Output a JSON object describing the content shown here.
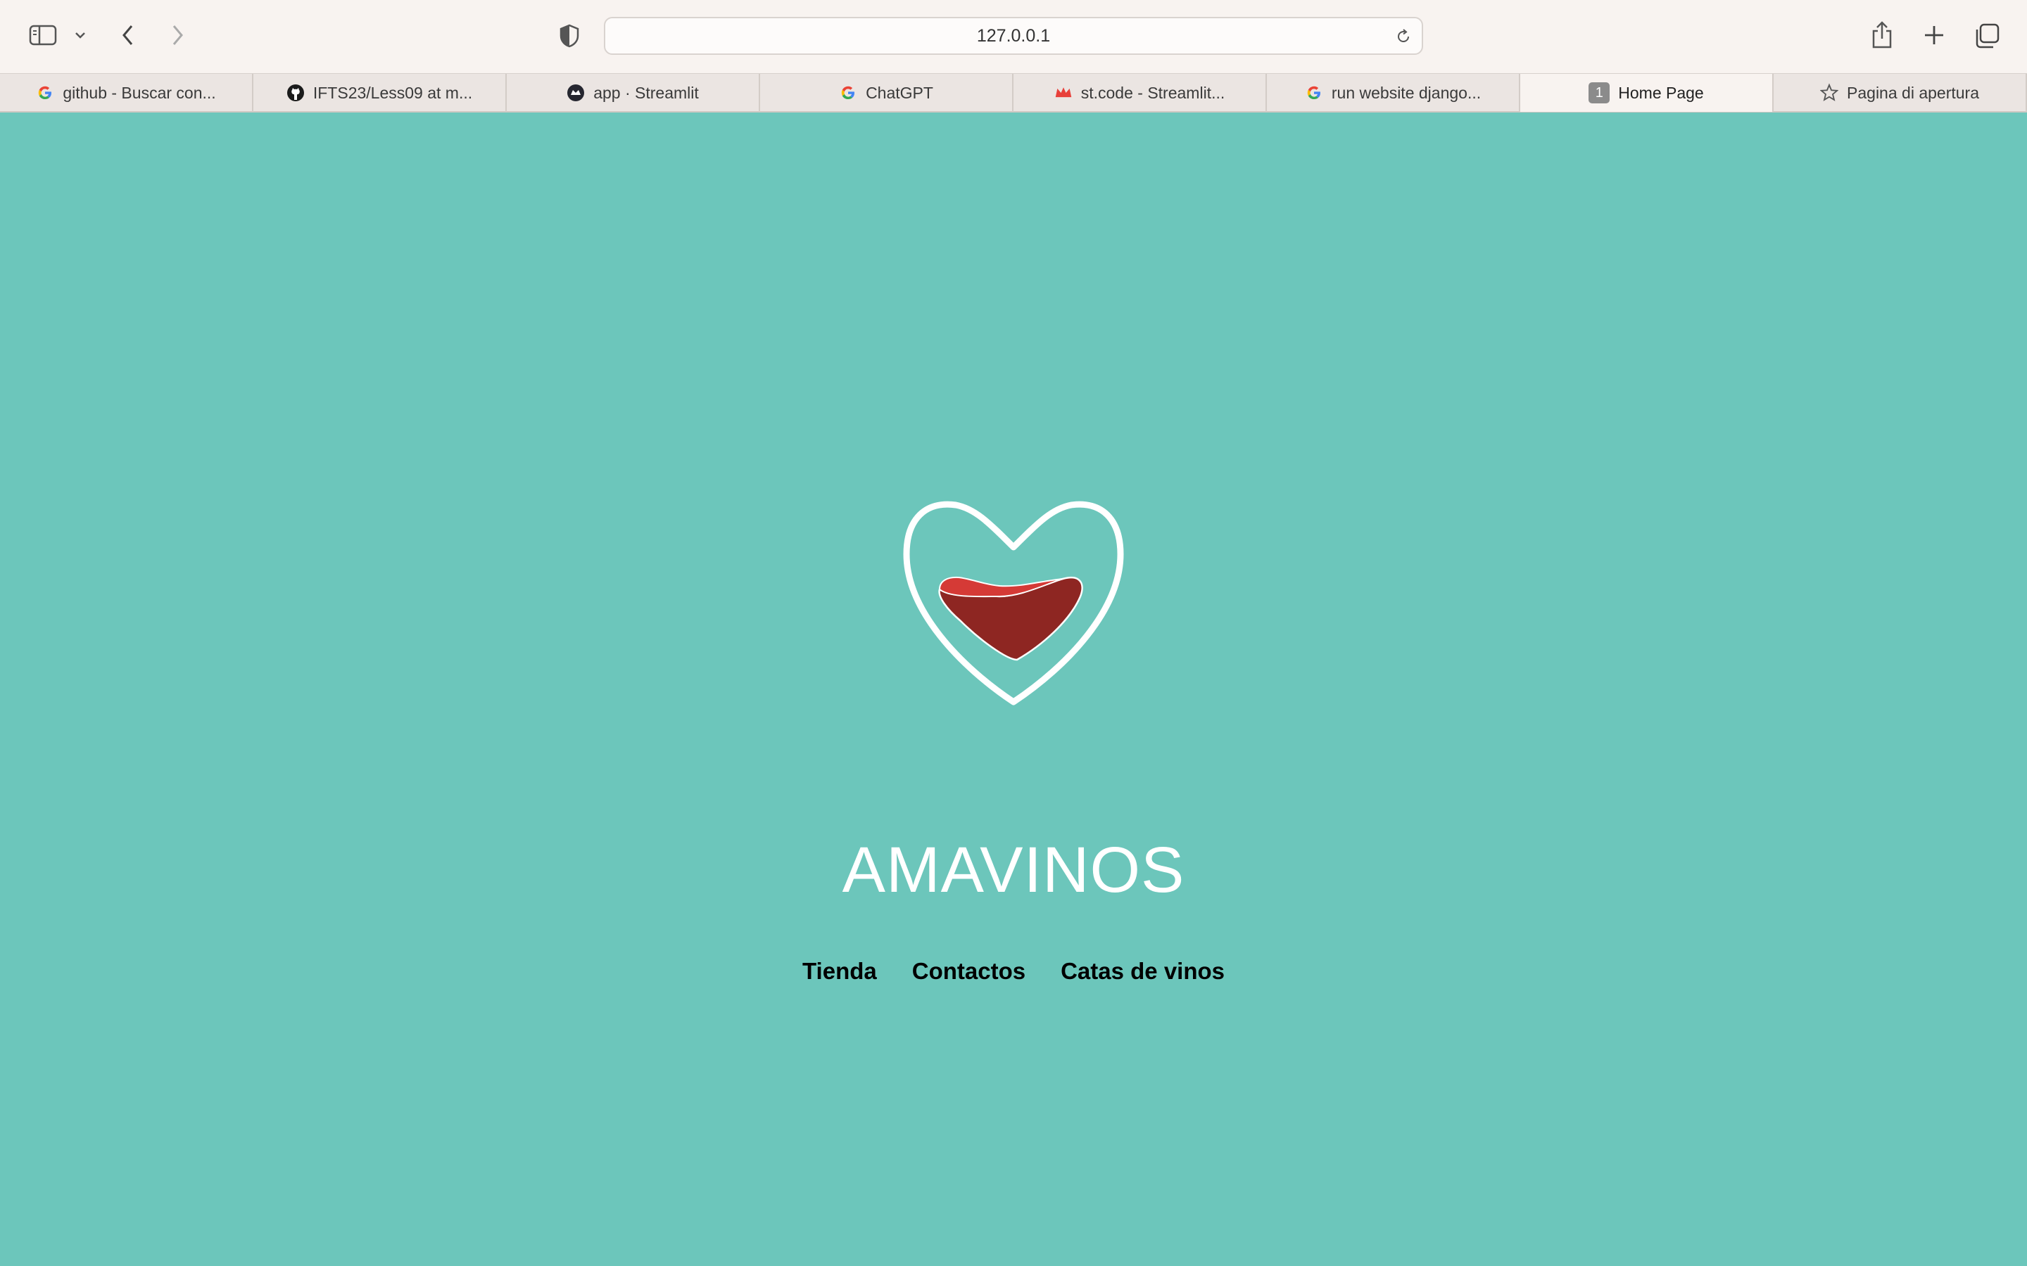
{
  "browser": {
    "url": "127.0.0.1",
    "tabs": [
      {
        "label": "github - Buscar con...",
        "favicon": "google-icon",
        "active": false
      },
      {
        "label": "IFTS23/Less09 at m...",
        "favicon": "github-icon",
        "active": false
      },
      {
        "label": "app · Streamlit",
        "favicon": "streamlit-icon",
        "active": false
      },
      {
        "label": "ChatGPT",
        "favicon": "google-icon",
        "active": false
      },
      {
        "label": "st.code - Streamlit...",
        "favicon": "streamlit-crown-icon",
        "active": false
      },
      {
        "label": "run website django...",
        "favicon": "google-icon",
        "active": false
      },
      {
        "label": "Home Page",
        "favicon": "tab-number-badge",
        "badge": "1",
        "active": true
      },
      {
        "label": "Pagina di apertura",
        "favicon": "star-icon",
        "active": false
      }
    ]
  },
  "site": {
    "brand": "AMAVINOS",
    "logo": "heart-wine-glass-icon",
    "nav": [
      {
        "label": "Tienda"
      },
      {
        "label": "Contactos"
      },
      {
        "label": "Catas de vinos"
      }
    ]
  },
  "colors": {
    "page_background": "#6cc6bb",
    "wine_light": "#d53a36",
    "wine_dark": "#8e2622",
    "logo_stroke": "#ffffff"
  }
}
